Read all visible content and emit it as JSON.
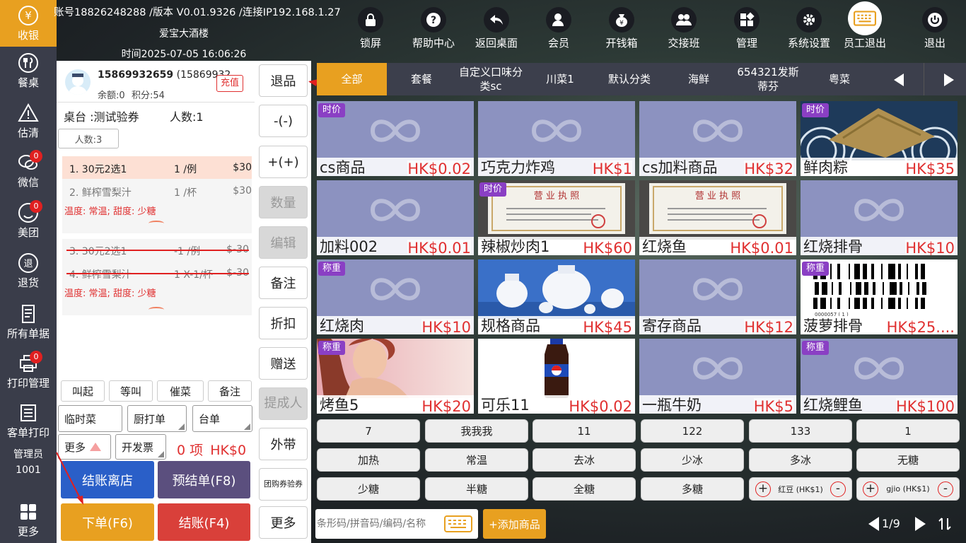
{
  "header": {
    "account_line": "账号18826248288 /版本 V0.01.9326 /连接IP192.168.1.27",
    "store_name": "爱宝大酒楼",
    "time_line": "时间2025-07-05 16:06:26"
  },
  "sidebar": {
    "items": [
      {
        "label": "收银",
        "icon": "yen-icon",
        "active": true
      },
      {
        "label": "餐桌",
        "icon": "utensils-icon"
      },
      {
        "label": "估清",
        "icon": "warning-icon"
      },
      {
        "label": "微信",
        "icon": "wechat-icon",
        "badge": "0"
      },
      {
        "label": "美团",
        "icon": "meituan-icon",
        "badge": "0"
      },
      {
        "label": "退货",
        "icon": "return-icon"
      },
      {
        "label": "所有单据",
        "icon": "documents-icon"
      },
      {
        "label": "打印管理",
        "icon": "printer-icon",
        "badge": "0"
      },
      {
        "label": "客单打印",
        "icon": "receipt-printer-icon"
      }
    ],
    "admin_label": "管理员",
    "admin_id": "1001",
    "more_label": "更多"
  },
  "toolbar": {
    "items": [
      {
        "label": "锁屏",
        "icon": "lock-icon"
      },
      {
        "label": "帮助中心",
        "icon": "help-icon"
      },
      {
        "label": "返回桌面",
        "icon": "back-icon"
      },
      {
        "label": "会员",
        "icon": "member-icon"
      },
      {
        "label": "开钱箱",
        "icon": "moneybag-icon"
      },
      {
        "label": "交接班",
        "icon": "shift-icon"
      },
      {
        "label": "管理",
        "icon": "grid-icon"
      },
      {
        "label": "系统设置",
        "icon": "gear-icon"
      },
      {
        "label": "员工退出",
        "icon": "keyboard-icon"
      },
      {
        "label": "退出",
        "icon": "power-icon"
      }
    ]
  },
  "member": {
    "phone": "15869932659",
    "phone_paren": "(15869932",
    "balance": "余额:0",
    "points": "积分:54",
    "recharge_label": "充值"
  },
  "table_info": {
    "table": "桌台 :测试验券",
    "people": "人数:1",
    "people_button": "人数:3"
  },
  "order": {
    "group1": [
      {
        "name": "1. 30元2选1",
        "qty": "1 /例",
        "price": "$30"
      },
      {
        "name": "2. 鲜榨雪梨汁",
        "qty": "1 /杯",
        "price": "$30"
      }
    ],
    "group1_note": "温度: 常温; 甜度: 少糖",
    "group2": [
      {
        "name": "3. 30元2选1",
        "qty": "-1 /例",
        "price": "$-30"
      },
      {
        "name": "4. 鲜榨雪梨汁",
        "qty": "1 X-1/杯",
        "price": "$-30"
      }
    ],
    "group2_note": "温度: 常温; 甜度: 少糖"
  },
  "left_actions": {
    "row1": [
      "叫起",
      "等叫",
      "催菜",
      "备注"
    ],
    "row2": [
      "临时菜",
      "厨打单",
      "台单"
    ],
    "more": "更多",
    "invoice": "开发票",
    "count": "0 项",
    "total": "HK$0",
    "checkout_leave": "结账离店",
    "pre_bill": "预结单(F8)",
    "place_order": "下单(F6)",
    "checkout": "结账(F4)"
  },
  "middle_actions": [
    {
      "label": "退品",
      "disabled": false
    },
    {
      "label": "-(-)",
      "disabled": false
    },
    {
      "label": "+(+)",
      "disabled": false
    },
    {
      "label": "数量",
      "disabled": true
    },
    {
      "label": "编辑",
      "disabled": true
    },
    {
      "label": "备注",
      "disabled": false
    },
    {
      "label": "折扣",
      "disabled": false
    },
    {
      "label": "赠送",
      "disabled": false
    },
    {
      "label": "提成人",
      "disabled": true
    },
    {
      "label": "外带",
      "disabled": false
    },
    {
      "label": "团购券验券",
      "disabled": false
    },
    {
      "label": "更多",
      "disabled": false
    }
  ],
  "categories": [
    "全部",
    "套餐",
    "自定义口味分类sc",
    "川菜1",
    "默认分类",
    "海鲜",
    "654321发斯蒂芬",
    "粤菜"
  ],
  "products": [
    {
      "name": "cs商品",
      "price": "HK$0.02",
      "tag": "时价",
      "image": "placeholder"
    },
    {
      "name": "巧克力炸鸡",
      "price": "HK$1",
      "tag": "",
      "image": "placeholder"
    },
    {
      "name": "cs加料商品",
      "price": "HK$32",
      "tag": "",
      "image": "placeholder"
    },
    {
      "name": "鲜肉粽",
      "price": "HK$35",
      "tag": "时价",
      "image": "zongzi"
    },
    {
      "name": "加料002",
      "price": "HK$0.01",
      "tag": "",
      "image": "placeholder"
    },
    {
      "name": "辣椒炒肉1",
      "price": "HK$60",
      "tag": "时价",
      "image": "license"
    },
    {
      "name": "红烧鱼",
      "price": "HK$0.01",
      "tag": "",
      "image": "license"
    },
    {
      "name": "红烧排骨",
      "price": "HK$10",
      "tag": "",
      "image": "placeholder"
    },
    {
      "name": "红烧肉",
      "price": "HK$10",
      "tag": "称重",
      "image": "placeholder"
    },
    {
      "name": "规格商品",
      "price": "HK$45",
      "tag": "",
      "image": "bottles"
    },
    {
      "name": "寄存商品",
      "price": "HK$12",
      "tag": "",
      "image": "placeholder"
    },
    {
      "name": "菠萝排骨",
      "price": "HK$25....",
      "tag": "称重",
      "image": "barcode"
    },
    {
      "name": "烤鱼5",
      "price": "HK$20",
      "tag": "称重",
      "image": "portrait"
    },
    {
      "name": "可乐11",
      "price": "HK$0.02",
      "tag": "",
      "image": "cola"
    },
    {
      "name": "一瓶牛奶",
      "price": "HK$5",
      "tag": "",
      "image": "placeholder"
    },
    {
      "name": "红烧鲤鱼",
      "price": "HK$100",
      "tag": "称重",
      "image": "placeholder"
    }
  ],
  "options": {
    "row1": [
      "7",
      "我我我",
      "11",
      "122",
      "133",
      "1"
    ],
    "row2": [
      "加热",
      "常温",
      "去冰",
      "少冰",
      "多冰",
      "无糖"
    ],
    "row3": [
      "少糖",
      "半糖",
      "全糖",
      "多糖"
    ],
    "addons": [
      {
        "name": "红豆 (HK$1)",
        "plus": "+",
        "minus": "-"
      },
      {
        "name": "gjio (HK$1)",
        "plus": "+",
        "minus": "-"
      }
    ]
  },
  "bottom": {
    "search_placeholder": "条形码/拼音码/编码/名称",
    "add_product": "+添加商品",
    "page": "1/9"
  },
  "colors": {
    "accent": "#e8a020",
    "sidebar": "#3a3d4a",
    "danger": "#d9403a",
    "primary": "#2a5fc8",
    "tag": "#8a3fc4",
    "price": "#e03030"
  }
}
